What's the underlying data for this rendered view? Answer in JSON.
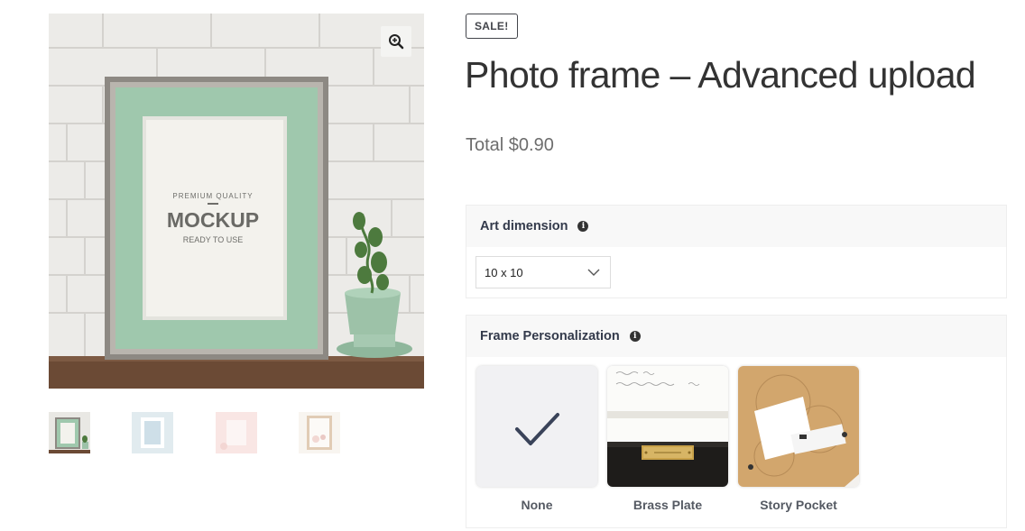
{
  "product": {
    "sale_badge": "SALE!",
    "title": "Photo frame – Advanced upload",
    "total": "Total $0.90"
  },
  "gallery": {
    "mockup_line1": "PREMIUM QUALITY",
    "mockup_line2": "MOCKUP",
    "mockup_line3": "READY TO USE",
    "thumbnails": [
      "thumbnail-1",
      "thumbnail-2",
      "thumbnail-3",
      "thumbnail-4"
    ]
  },
  "options": {
    "art_dimension": {
      "label": "Art dimension",
      "selected": "10 x 10"
    },
    "frame_personalization": {
      "label": "Frame Personalization",
      "choices": [
        {
          "label": "None",
          "selected": true
        },
        {
          "label": "Brass Plate",
          "selected": false
        },
        {
          "label": "Story Pocket",
          "selected": false
        }
      ]
    }
  },
  "colors": {
    "mat_green": "#9fc8ad",
    "selected_check": "#3a4359",
    "brass": "#c9a24a"
  },
  "icons": {
    "zoom": "magnifier-plus-icon",
    "info": "info-icon",
    "dropdown": "chevron-down-icon",
    "check": "check-icon"
  }
}
